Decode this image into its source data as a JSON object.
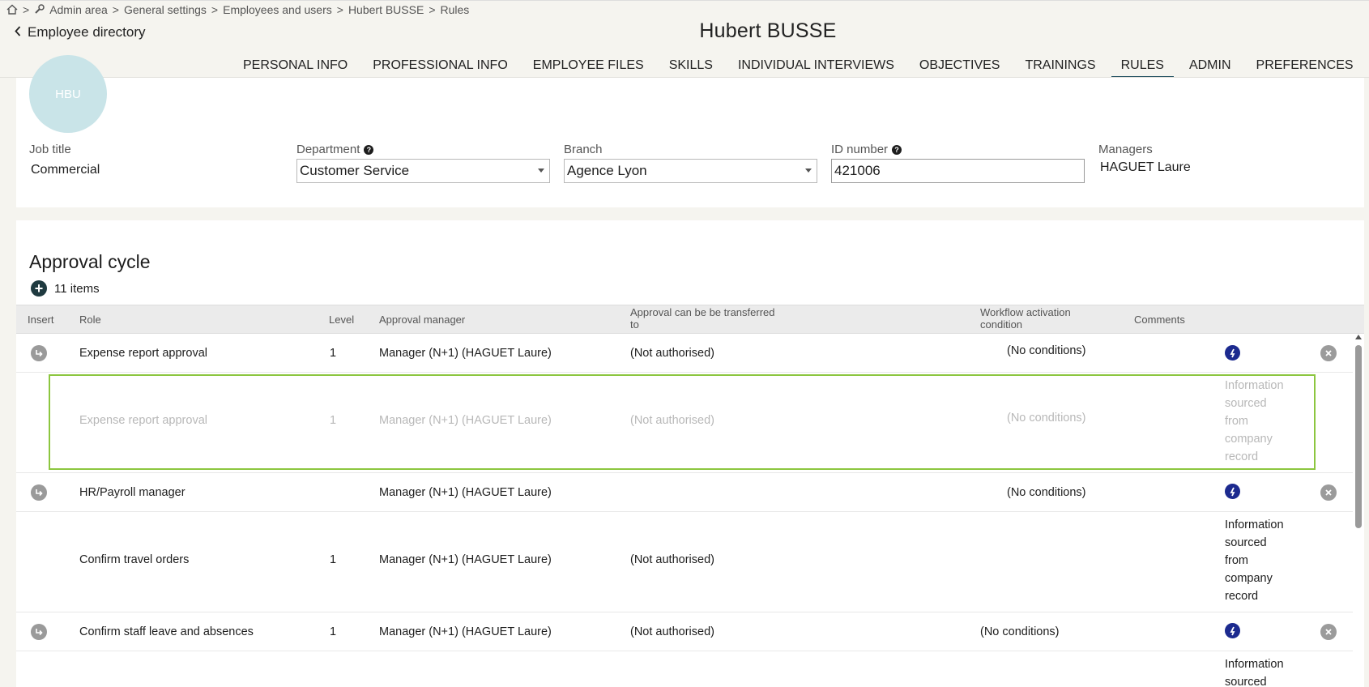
{
  "breadcrumb": {
    "sep": ">",
    "items": [
      "Admin area",
      "General settings",
      "Employees and users",
      "Hubert BUSSE",
      "Rules"
    ]
  },
  "header": {
    "back_label": "Employee directory",
    "title": "Hubert BUSSE"
  },
  "tabs": [
    {
      "label": "PERSONAL INFO"
    },
    {
      "label": "PROFESSIONAL INFO"
    },
    {
      "label": "EMPLOYEE FILES"
    },
    {
      "label": "SKILLS"
    },
    {
      "label": "INDIVIDUAL INTERVIEWS"
    },
    {
      "label": "OBJECTIVES"
    },
    {
      "label": "TRAININGS"
    },
    {
      "label": "RULES",
      "active": true
    },
    {
      "label": "ADMIN"
    },
    {
      "label": "PREFERENCES"
    }
  ],
  "profile": {
    "avatar_initials": "HBU",
    "job_title_label": "Job title",
    "job_title": "Commercial",
    "department_label": "Department",
    "department": "Customer Service",
    "branch_label": "Branch",
    "branch": "Agence Lyon",
    "id_label": "ID number",
    "id_number": "421006",
    "managers_label": "Managers",
    "managers": "HAGUET Laure"
  },
  "approval": {
    "title": "Approval cycle",
    "items_count": "11 items",
    "columns": {
      "insert": "Insert",
      "role": "Role",
      "level": "Level",
      "manager": "Approval manager",
      "transfer_1": "Approval can be be transferred",
      "transfer_2": "to",
      "workflow_1": "Workflow activation",
      "workflow_2": "condition",
      "comments": "Comments"
    },
    "rows": [
      {
        "role": "Expense report approval",
        "level": "1",
        "manager": "Manager (N+1) (HAGUET Laure)",
        "transfer": "(Not authorised)",
        "condition": "(No conditions)",
        "comment": ""
      },
      {
        "role": "Expense report approval",
        "level": "1",
        "manager": "Manager (N+1) (HAGUET Laure)",
        "transfer": "(Not authorised)",
        "condition": "(No conditions)",
        "comment_lines": [
          "Information",
          "sourced",
          "from",
          "company",
          "record"
        ]
      },
      {
        "role": "HR/Payroll manager",
        "level": "",
        "manager": "Manager (N+1) (HAGUET Laure)",
        "transfer": "",
        "condition": "(No conditions)",
        "comment": ""
      },
      {
        "role": "Confirm travel orders",
        "level": "1",
        "manager": "Manager (N+1) (HAGUET Laure)",
        "transfer": "(Not authorised)",
        "condition": "",
        "comment_lines": [
          "Information",
          "sourced",
          "from",
          "company",
          "record"
        ]
      },
      {
        "role": "Confirm staff leave and absences",
        "level": "1",
        "manager": "Manager (N+1) (HAGUET Laure)",
        "transfer": "(Not authorised)",
        "condition": "(No conditions)",
        "comment": ""
      },
      {
        "comment_lines": [
          "Information",
          "sourced"
        ]
      }
    ]
  },
  "colors": {
    "accent": "#1f4e5f",
    "ghost_outline": "#8cc63f",
    "info_icon": "#1c2a8f"
  }
}
